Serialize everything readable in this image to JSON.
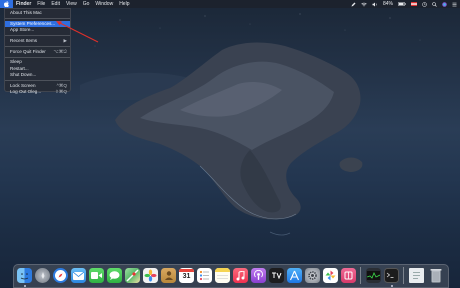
{
  "menubar": {
    "apple_icon": "apple-logo-icon",
    "app_name": "Finder",
    "items": [
      "File",
      "Edit",
      "View",
      "Go",
      "Window",
      "Help"
    ],
    "status": {
      "battery_percent": "84%",
      "icons": [
        "pen-icon",
        "wifi-icon",
        "volume-icon",
        "battery-icon",
        "flag-icon",
        "clock-icon",
        "search-icon",
        "siri-icon",
        "control-center-icon"
      ]
    }
  },
  "apple_menu": {
    "about": "About This Mac",
    "system_preferences": "System Preferences...",
    "app_store": "App Store...",
    "recent_items": "Recent Items",
    "recent_items_arrow": "▶",
    "force_quit": "Force Quit Finder",
    "force_quit_shortcut": "⌥⌘⎋",
    "sleep": "Sleep",
    "restart": "Restart...",
    "shut_down": "Shut Down...",
    "lock_screen": "Lock Screen",
    "lock_screen_shortcut": "^⌘Q",
    "log_out": "Log Out Oleg...",
    "log_out_shortcut": "⇧⌘Q"
  },
  "dock": {
    "calendar_day": "31",
    "items": [
      {
        "name": "finder",
        "color": "#3f8fe8"
      },
      {
        "name": "launchpad",
        "color": "#8a8f98"
      },
      {
        "name": "safari",
        "color": "#2d7be0"
      },
      {
        "name": "mail",
        "color": "#4aa3f0"
      },
      {
        "name": "facetime",
        "color": "#3cc04e"
      },
      {
        "name": "messages",
        "color": "#3cc04e"
      },
      {
        "name": "maps",
        "color": "#58b86a"
      },
      {
        "name": "photos",
        "color": "#f2f2f2"
      },
      {
        "name": "contacts",
        "color": "#c9974a"
      },
      {
        "name": "calendar",
        "color": "#ffffff"
      },
      {
        "name": "reminders",
        "color": "#ffffff"
      },
      {
        "name": "notes",
        "color": "#f5d451"
      },
      {
        "name": "music",
        "color": "#f0455f"
      },
      {
        "name": "podcasts",
        "color": "#9b4fd8"
      },
      {
        "name": "tv",
        "color": "#222222"
      },
      {
        "name": "app-store",
        "color": "#2f8ef0"
      },
      {
        "name": "system-preferences",
        "color": "#8a8f98"
      },
      {
        "name": "pinwheel-app",
        "color": "#ffffff"
      },
      {
        "name": "red-app",
        "color": "#e84a78"
      },
      {
        "name": "activity-monitor",
        "color": "#2a2e34"
      },
      {
        "name": "terminal",
        "color": "#1c1c1c"
      },
      {
        "name": "downloads-file",
        "color": "#e9ecef"
      },
      {
        "name": "trash",
        "color": "#9aa0a8"
      }
    ]
  }
}
